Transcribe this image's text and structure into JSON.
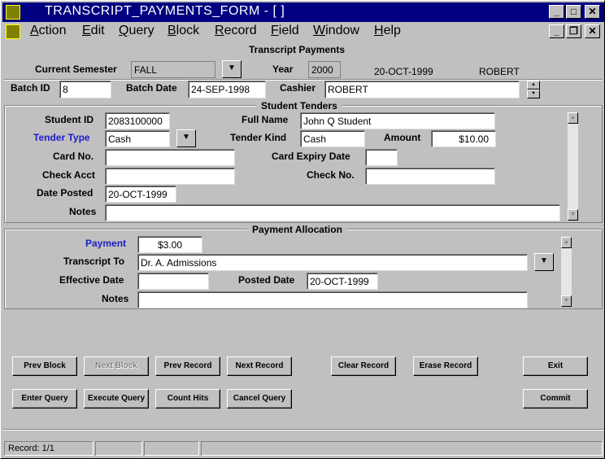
{
  "window": {
    "title": "TRANSCRIPT_PAYMENTS_FORM - [ ]",
    "minimize": "_",
    "maximize": "□",
    "close": "✕",
    "doc_minimize": "_",
    "doc_restore": "❐",
    "doc_close": "✕"
  },
  "menu": [
    {
      "key": "A",
      "rest": "ction"
    },
    {
      "key": "E",
      "rest": "dit"
    },
    {
      "key": "Q",
      "rest": "uery"
    },
    {
      "key": "B",
      "rest": "lock"
    },
    {
      "key": "R",
      "rest": "ecord"
    },
    {
      "key": "F",
      "rest": "ield"
    },
    {
      "key": "W",
      "rest": "indow"
    },
    {
      "key": "H",
      "rest": "elp"
    }
  ],
  "header": {
    "title": "Transcript Payments",
    "semester_label": "Current Semester",
    "semester_value": "FALL",
    "year_label": "Year",
    "year_value": "2000",
    "date": "20-OCT-1999",
    "user": "ROBERT"
  },
  "batch": {
    "batch_id_label": "Batch ID",
    "batch_id_value": "8",
    "batch_date_label": "Batch Date",
    "batch_date_value": "24-SEP-1998",
    "cashier_label": "Cashier",
    "cashier_value": "ROBERT"
  },
  "tenders": {
    "title": "Student Tenders",
    "student_id_label": "Student ID",
    "student_id_value": "2083100000",
    "full_name_label": "Full Name",
    "full_name_value": "John Q Student",
    "tender_type_label": "Tender Type",
    "tender_type_value": "Cash",
    "tender_kind_label": "Tender Kind",
    "tender_kind_value": "Cash",
    "amount_label": "Amount",
    "amount_value": "$10.00",
    "card_no_label": "Card No.",
    "card_no_value": "",
    "card_expiry_label": "Card Expiry Date",
    "card_expiry_value": "",
    "check_acct_label": "Check Acct",
    "check_acct_value": "",
    "check_no_label": "Check No.",
    "check_no_value": "",
    "date_posted_label": "Date Posted",
    "date_posted_value": "20-OCT-1999",
    "notes_label": "Notes",
    "notes_value": ""
  },
  "allocation": {
    "title": "Payment Allocation",
    "payment_label": "Payment",
    "payment_value": "$3.00",
    "transcript_to_label": "Transcript To",
    "transcript_to_value": "Dr. A. Admissions",
    "effective_date_label": "Effective Date",
    "effective_date_value": "",
    "posted_date_label": "Posted Date",
    "posted_date_value": "20-OCT-1999",
    "notes_label": "Notes",
    "notes_value": ""
  },
  "buttons": {
    "prev_block": "Prev Block",
    "next_block": "Next Block",
    "prev_record": "Prev Record",
    "next_record": "Next Record",
    "clear_record": "Clear Record",
    "erase_record": "Erase Record",
    "exit": "Exit",
    "enter_query": "Enter Query",
    "execute_query": "Execute Query",
    "count_hits": "Count Hits",
    "cancel_query": "Cancel Query",
    "commit": "Commit"
  },
  "status": {
    "record": "Record: 1/1"
  },
  "icons": {
    "lov": "▼",
    "scroll_up": "▲",
    "scroll_down": "▼",
    "spin_up": "▲",
    "spin_down": "▼"
  },
  "colors": {
    "titlebar": "#000080",
    "face": "#c0c0c0",
    "required_label": "#1c1cc8"
  }
}
